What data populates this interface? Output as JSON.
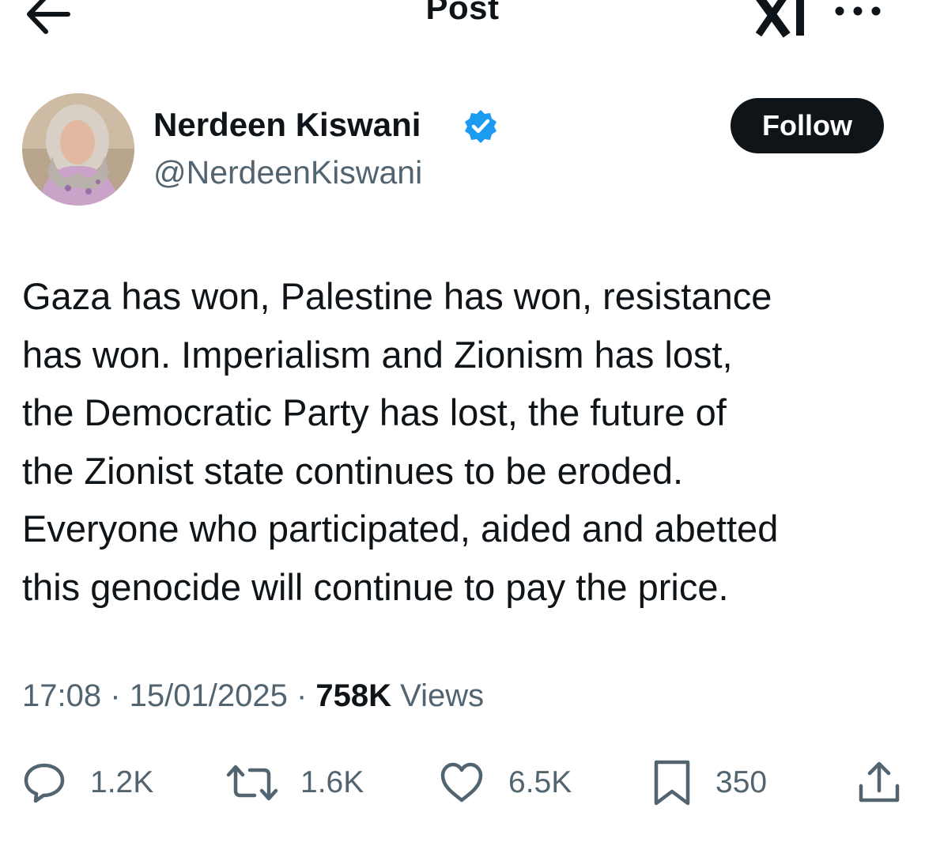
{
  "header": {
    "title": "Post",
    "back_icon": "back-arrow-icon",
    "grok_icon": "grok-icon",
    "more_icon": "more-options-icon"
  },
  "author": {
    "name": "Nerdeen Kiswani",
    "handle": "@NerdeenKiswani",
    "verified": true,
    "verified_color": "#1d9bf0",
    "follow_label": "Follow"
  },
  "post": {
    "lines": [
      "Gaza has won, Palestine has won, resistance",
      "has won. Imperialism and Zionism has lost,",
      "the Democratic Party has lost, the future of",
      "the Zionist state continues to be eroded.",
      "Everyone who participated, aided and abetted",
      "this genocide will continue to pay the price."
    ]
  },
  "meta": {
    "time": "17:08",
    "sep1": " · ",
    "date": "15/01/2025",
    "sep2": " · ",
    "views_count": "758K",
    "views_label": " Views"
  },
  "actions": {
    "replies": "1.2K",
    "reposts": "1.6K",
    "likes": "6.5K",
    "bookmarks": "350"
  },
  "colors": {
    "text": "#0f1419",
    "secondary": "#536471",
    "follow_bg": "#0f1419"
  }
}
